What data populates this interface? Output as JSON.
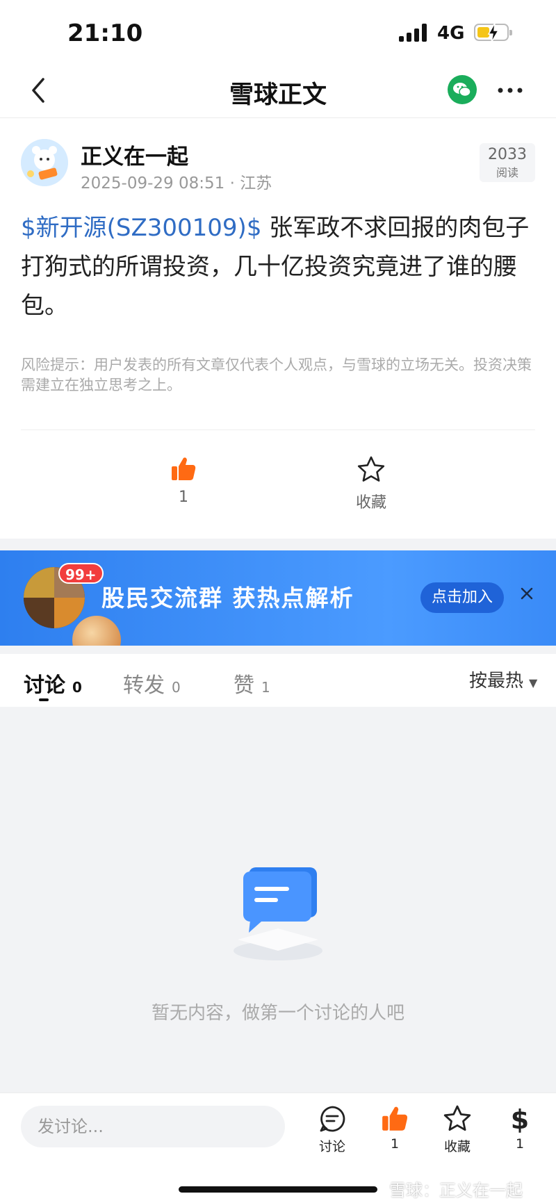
{
  "status": {
    "time": "21:10",
    "network": "4G"
  },
  "nav": {
    "title": "雪球正文"
  },
  "author": {
    "name": "正义在一起",
    "date": "2025-09-29 08:51",
    "location": "江苏",
    "read_count": "2033",
    "read_label": "阅读"
  },
  "post": {
    "stock_tag": "$新开源(SZ300109)$",
    "body": " 张军政不求回报的肉包子打狗式的所谓投资，几十亿投资究竟进了谁的腰包。"
  },
  "risk_notice": "风险提示：用户发表的所有文章仅代表个人观点，与雪球的立场无关。投资决策需建立在独立思考之上。",
  "actions": {
    "like_count": "1",
    "favorite_label": "收藏"
  },
  "banner": {
    "badge": "99+",
    "text": "股民交流群  获热点解析",
    "join_label": "点击加入"
  },
  "tabs": [
    {
      "label": "讨论",
      "count": "0"
    },
    {
      "label": "转发",
      "count": "0"
    },
    {
      "label": "赞",
      "count": "1"
    }
  ],
  "sort_label": "按最热",
  "empty_text": "暂无内容，做第一个讨论的人吧",
  "bottom": {
    "input_placeholder": "发讨论...",
    "discuss_label": "讨论",
    "like_count": "1",
    "favorite_label": "收藏",
    "reward_count": "1"
  },
  "watermark": "雪球：正义在一起",
  "colors": {
    "link": "#2f6cc4",
    "like": "#ff6a13",
    "banner": "#3a8bf7",
    "wechat": "#1aad5b"
  }
}
